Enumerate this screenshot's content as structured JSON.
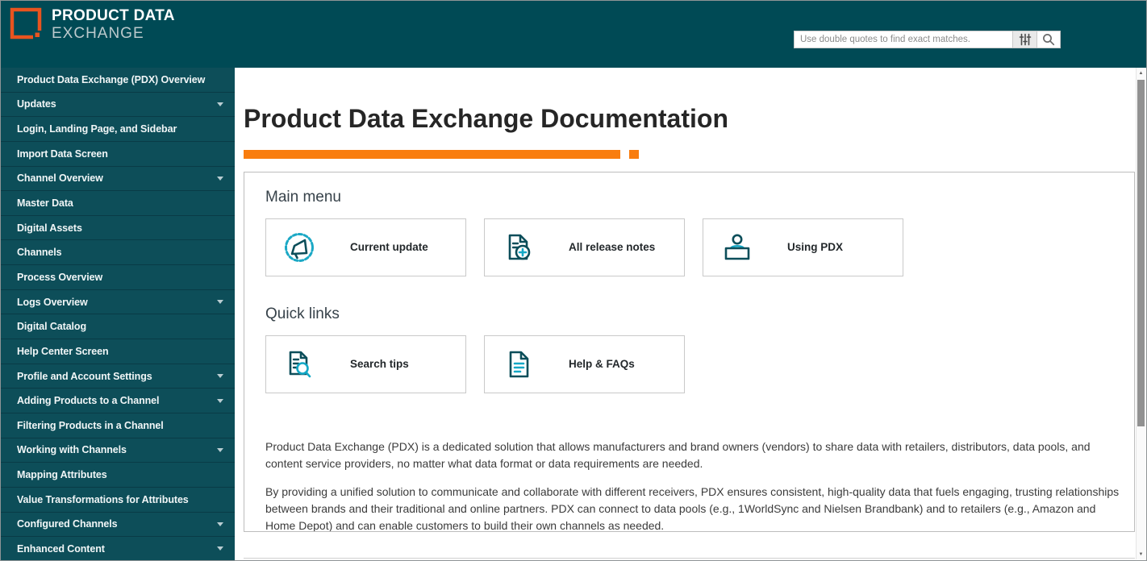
{
  "header": {
    "logo_line1": "PRODUCT DATA",
    "logo_line2": "EXCHANGE",
    "search_placeholder": "Use double quotes to find exact matches."
  },
  "sidebar": {
    "items": [
      {
        "label": "Product Data Exchange (PDX) Overview",
        "expandable": false
      },
      {
        "label": "Updates",
        "expandable": true
      },
      {
        "label": "Login, Landing Page, and Sidebar",
        "expandable": false
      },
      {
        "label": "Import Data Screen",
        "expandable": false
      },
      {
        "label": "Channel Overview",
        "expandable": true
      },
      {
        "label": "Master Data",
        "expandable": false
      },
      {
        "label": "Digital Assets",
        "expandable": false
      },
      {
        "label": "Channels",
        "expandable": false
      },
      {
        "label": "Process Overview",
        "expandable": false
      },
      {
        "label": "Logs Overview",
        "expandable": true
      },
      {
        "label": "Digital Catalog",
        "expandable": false
      },
      {
        "label": "Help Center Screen",
        "expandable": false
      },
      {
        "label": "Profile and Account Settings",
        "expandable": true
      },
      {
        "label": "Adding Products to a Channel",
        "expandable": true
      },
      {
        "label": "Filtering Products in a Channel",
        "expandable": false
      },
      {
        "label": "Working with Channels",
        "expandable": true
      },
      {
        "label": "Mapping Attributes",
        "expandable": false
      },
      {
        "label": "Value Transformations for Attributes",
        "expandable": false
      },
      {
        "label": "Configured Channels",
        "expandable": true
      },
      {
        "label": "Enhanced Content",
        "expandable": true
      }
    ]
  },
  "main": {
    "title": "Product Data Exchange Documentation",
    "sections": [
      {
        "heading": "Main menu",
        "cards": [
          {
            "label": "Current update",
            "icon": "megaphone-seal-icon"
          },
          {
            "label": "All release notes",
            "icon": "document-add-icon"
          },
          {
            "label": "Using PDX",
            "icon": "person-desk-icon"
          }
        ]
      },
      {
        "heading": "Quick links",
        "cards": [
          {
            "label": "Search tips",
            "icon": "document-search-icon"
          },
          {
            "label": "Help & FAQs",
            "icon": "document-text-icon"
          }
        ]
      }
    ],
    "paragraphs": [
      "Product Data Exchange (PDX) is a dedicated solution that allows manufacturers and brand owners (vendors) to share data with retailers, distributors, data pools, and content service providers, no matter what data format or data requirements are needed.",
      "By providing a unified solution to communicate and collaborate with different receivers, PDX ensures consistent, high-quality data that fuels engaging, trusting relationships between brands and their traditional and online partners. PDX can connect to data pools (e.g., 1WorldSync and Nielsen Brandbank) and to retailers (e.g., Amazon and Home Depot) and can enable customers to build their own channels as needed."
    ]
  },
  "colors": {
    "header_bg": "#004a55",
    "sidebar_bg": "#0d4e59",
    "sidebar_divider": "#093b46",
    "accent_orange": "#f97d0e",
    "logo_orange": "#e8541f",
    "icon_dark_teal": "#0c4e5a",
    "icon_cyan": "#14a8c6"
  }
}
